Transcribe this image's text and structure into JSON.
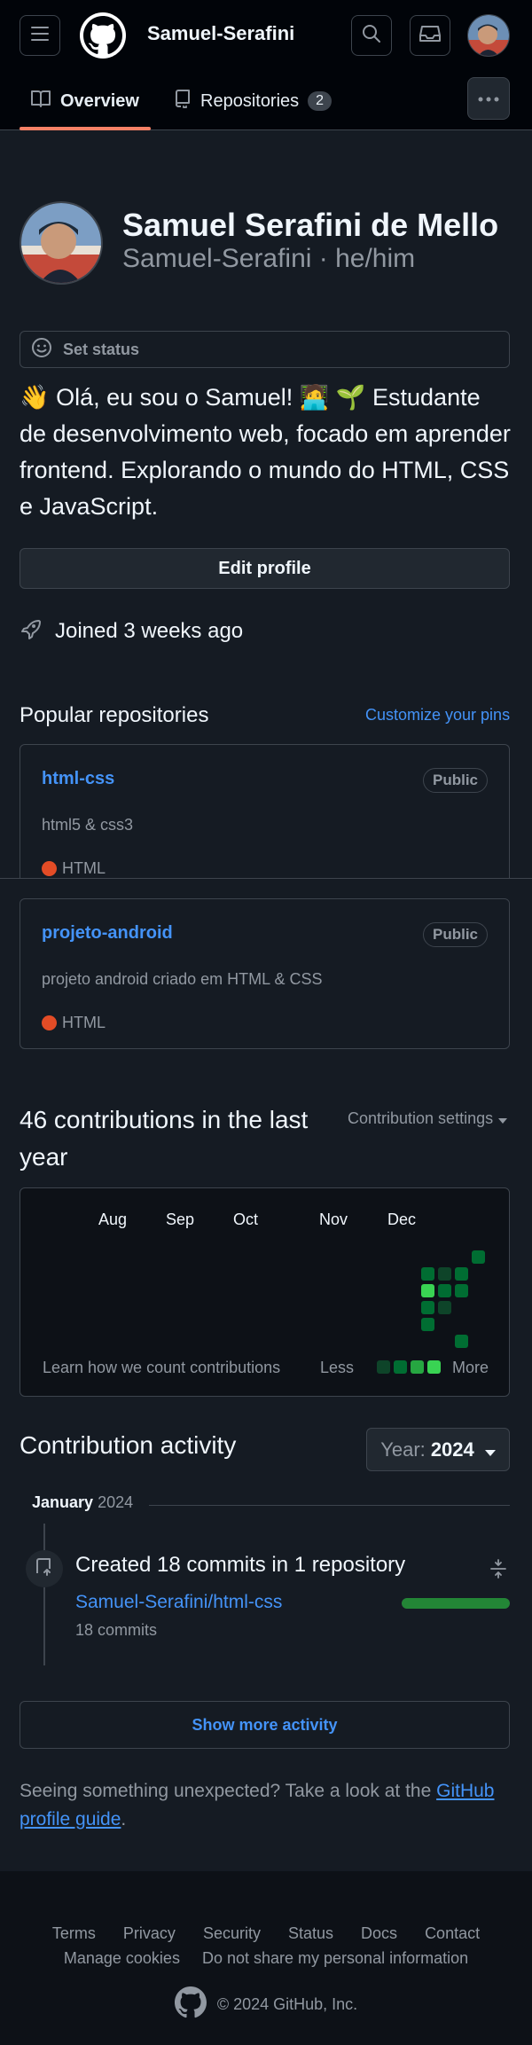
{
  "header": {
    "username": "Samuel-Serafini",
    "menu_icon": "hamburger-icon",
    "search_icon": "search-icon",
    "inbox_icon": "inbox-icon"
  },
  "nav": {
    "tabs": [
      {
        "label": "Overview",
        "selected": true,
        "icon": "book-icon"
      },
      {
        "label": "Repositories",
        "count": "2",
        "icon": "repo-icon"
      }
    ],
    "more_icon": "kebab-icon"
  },
  "profile": {
    "name": "Samuel Serafini de Mello",
    "login_line": "Samuel-Serafini · he/him",
    "set_status": "Set status",
    "bio": "👋 Olá, eu sou o Samuel! 🧑‍💻 🌱 Estudante de desenvolvimento web, focado em aprender frontend. Explorando o mundo do HTML, CSS e JavaScript.",
    "edit_profile": "Edit profile",
    "joined": "Joined 3 weeks ago"
  },
  "popular": {
    "title": "Popular repositories",
    "customize": "Customize your pins",
    "repos": [
      {
        "name": "html-css",
        "visibility": "Public",
        "description": "html5 & css3",
        "language": "HTML",
        "lang_color": "#e34c26"
      },
      {
        "name": "projeto-android",
        "visibility": "Public",
        "description": "projeto android criado em HTML & CSS",
        "language": "HTML",
        "lang_color": "#e34c26"
      }
    ]
  },
  "contributions": {
    "title": "46 contributions in the last year",
    "settings": "Contribution settings",
    "months": [
      "Aug",
      "Sep",
      "Oct",
      "Nov",
      "Dec"
    ],
    "learn": "Learn how we count contributions",
    "legend_less": "Less",
    "legend_more": "More"
  },
  "activity": {
    "title": "Contribution activity",
    "year_label": "Year:",
    "year_value": "2024",
    "month": "January",
    "month_year": "2024",
    "summary": "Created 18 commits in 1 repository",
    "repo": "Samuel-Serafini/html-css",
    "commits": "18 commits",
    "commit_share": 1.0,
    "show_more": "Show more activity"
  },
  "guide": {
    "text_before": "Seeing something unexpected? Take a look at the ",
    "link": "GitHub profile guide",
    "text_after": "."
  },
  "footer": {
    "links": [
      "Terms",
      "Privacy",
      "Security",
      "Status",
      "Docs",
      "Contact"
    ],
    "links2": [
      "Manage cookies",
      "Do not share my personal information"
    ],
    "copyright": "© 2024 GitHub, Inc."
  }
}
